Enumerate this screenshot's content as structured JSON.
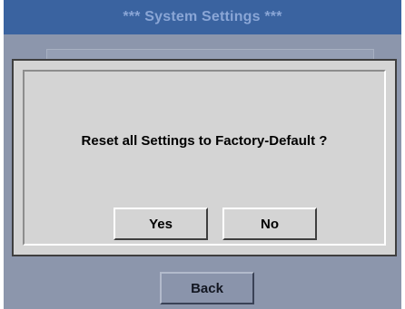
{
  "title_bar": {
    "title": "***   System Settings   ***"
  },
  "dialog": {
    "message": "Reset all Settings to Factory-Default ?",
    "yes_label": "Yes",
    "no_label": "No"
  },
  "background": {
    "back_label": "Back"
  },
  "colors": {
    "title_bar": "#3a63a0",
    "title_text": "#8aa6d6",
    "dimmed_background": "#8c96ac",
    "dialog_face": "#d4d4d4"
  }
}
